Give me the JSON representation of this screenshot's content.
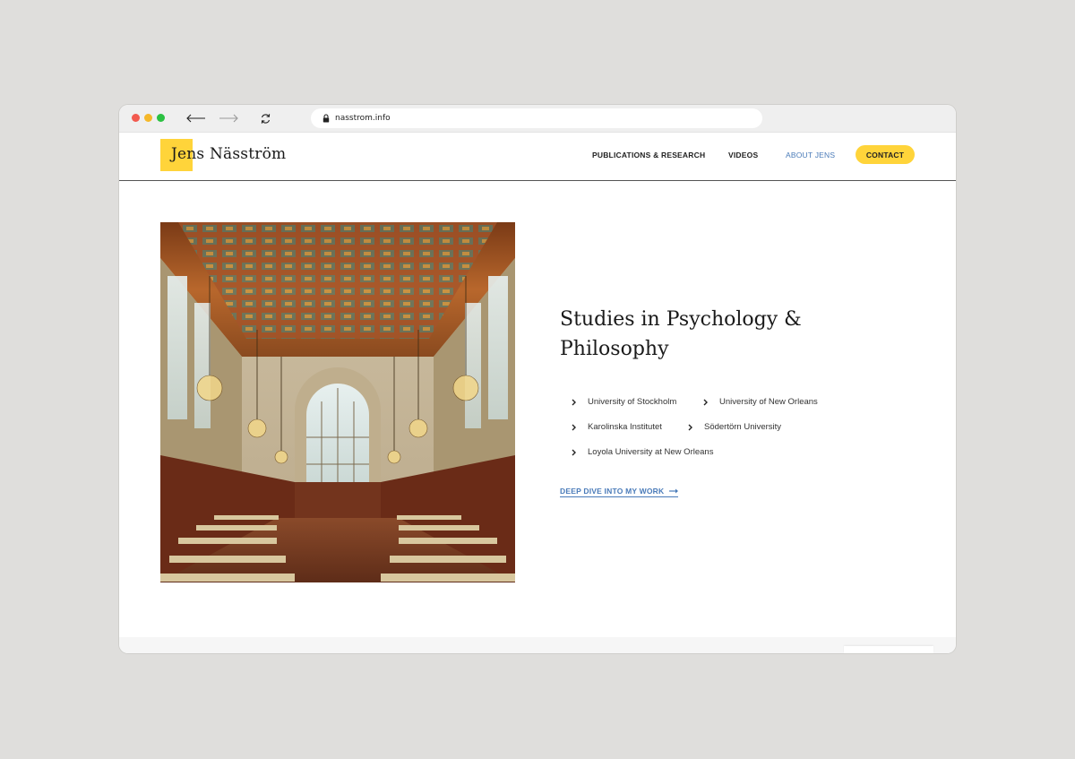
{
  "browser": {
    "url": "nasstrom.info"
  },
  "site": {
    "logo_text": "Jens Näsström",
    "nav": [
      {
        "label": "PUBLICATIONS & RESEARCH"
      },
      {
        "label": "VIDEOS"
      },
      {
        "label": "ABOUT JENS"
      }
    ],
    "contact_label": "CONTACT"
  },
  "main": {
    "heading": "Studies in Psychology & Philosophy",
    "universities": [
      "University of Stockholm",
      "University of New Orleans",
      "Karolinska Institutet",
      "Södertörn University",
      "Loyola University at New Orleans"
    ],
    "cta_label": "DEEP DIVE INTO MY WORK"
  },
  "colors": {
    "accent_yellow": "#ffd43a",
    "link_blue": "#4a7bb9",
    "page_background": "#dfdedc"
  },
  "icons": [
    "back-arrow-icon",
    "forward-arrow-icon",
    "reload-icon",
    "lock-icon",
    "chevron-right-icon",
    "arrow-right-icon"
  ]
}
